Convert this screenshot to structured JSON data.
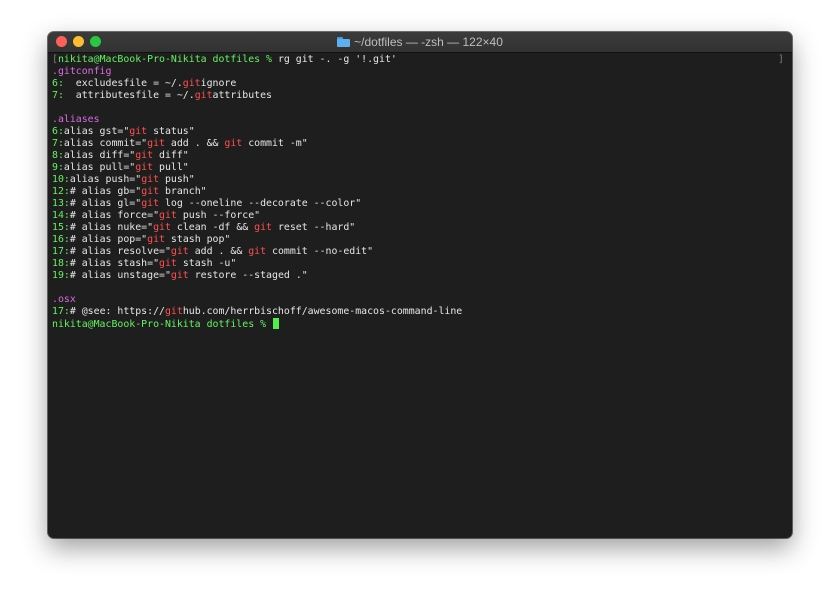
{
  "window": {
    "title": "~/dotfiles — -zsh — 122×40",
    "folder_icon": "folder-icon",
    "colors": {
      "background": "#1e1e1e",
      "prompt_green": "#63f45e",
      "heading_magenta": "#d96be0",
      "match_red": "#ff4f4f",
      "cursor": "#4ef04a"
    }
  },
  "terminal": {
    "command_line": {
      "bracket_open": "[",
      "prompt": "nikita@MacBook-Pro-Nikita dotfiles % ",
      "command": "rg git -. -g '!.git'",
      "bracket_close": "]"
    },
    "groups": [
      {
        "file": ".gitconfig",
        "lines": [
          {
            "num": "6:",
            "parts": [
              "  excludesfile = ~/.",
              "git",
              "ignore"
            ]
          },
          {
            "num": "7:",
            "parts": [
              "  attributesfile = ~/.",
              "git",
              "attributes"
            ]
          }
        ]
      },
      {
        "file": ".aliases",
        "lines": [
          {
            "num": "6:",
            "parts": [
              "alias gst=\"",
              "git",
              " status\""
            ]
          },
          {
            "num": "7:",
            "parts": [
              "alias commit=\"",
              "git",
              " add . && ",
              "git",
              " commit -m\""
            ]
          },
          {
            "num": "8:",
            "parts": [
              "alias diff=\"",
              "git",
              " diff\""
            ]
          },
          {
            "num": "9:",
            "parts": [
              "alias pull=\"",
              "git",
              " pull\""
            ]
          },
          {
            "num": "10:",
            "parts": [
              "alias push=\"",
              "git",
              " push\""
            ]
          },
          {
            "num": "12:",
            "parts": [
              "# alias gb=\"",
              "git",
              " branch\""
            ]
          },
          {
            "num": "13:",
            "parts": [
              "# alias gl=\"",
              "git",
              " log --oneline --decorate --color\""
            ]
          },
          {
            "num": "14:",
            "parts": [
              "# alias force=\"",
              "git",
              " push --force\""
            ]
          },
          {
            "num": "15:",
            "parts": [
              "# alias nuke=\"",
              "git",
              " clean -df && ",
              "git",
              " reset --hard\""
            ]
          },
          {
            "num": "16:",
            "parts": [
              "# alias pop=\"",
              "git",
              " stash pop\""
            ]
          },
          {
            "num": "17:",
            "parts": [
              "# alias resolve=\"",
              "git",
              " add . && ",
              "git",
              " commit --no-edit\""
            ]
          },
          {
            "num": "18:",
            "parts": [
              "# alias stash=\"",
              "git",
              " stash -u\""
            ]
          },
          {
            "num": "19:",
            "parts": [
              "# alias unstage=\"",
              "git",
              " restore --staged .\""
            ]
          }
        ]
      },
      {
        "file": ".osx",
        "lines": [
          {
            "num": "17:",
            "parts": [
              "# @see: https://",
              "git",
              "hub.com/herrbischoff/awesome-macos-command-line"
            ]
          }
        ]
      }
    ],
    "final_prompt": "nikita@MacBook-Pro-Nikita dotfiles % "
  }
}
